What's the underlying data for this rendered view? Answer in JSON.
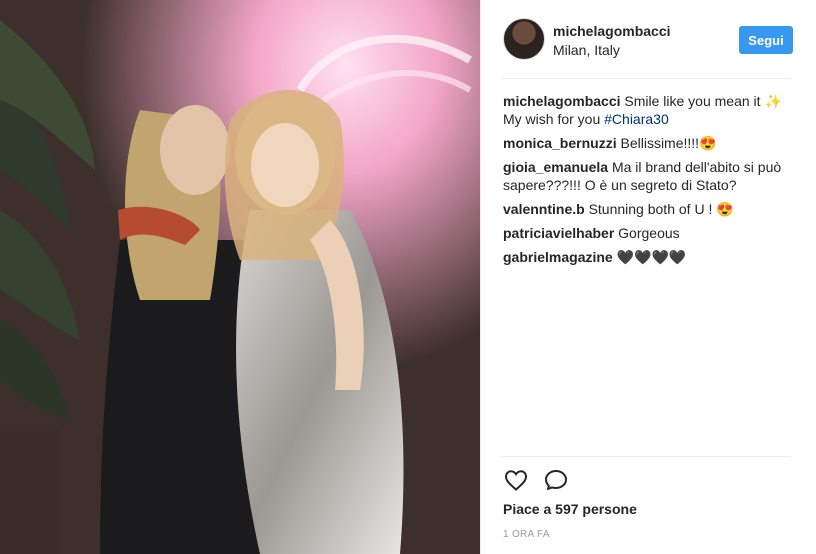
{
  "post": {
    "photo_description": "photo",
    "header": {
      "username": "michelagombacci",
      "location": "Milan, Italy",
      "follow_label": "Segui"
    },
    "caption": {
      "username": "michelagombacci",
      "text": "Smile like you mean it ✨ My wish for you ",
      "hashtag": "#Chiara30"
    },
    "comments": [
      {
        "username": "monica_bernuzzi",
        "text": "Bellissime!!!!😍"
      },
      {
        "username": "gioia_emanuela",
        "text": "Ma il brand dell'abito si può sapere???!!! O è un segreto di Stato?"
      },
      {
        "username": "valenntine.b",
        "text": "Stunning both of U ! 😍"
      },
      {
        "username": "patriciavielhaber",
        "text": "Gorgeous"
      },
      {
        "username": "gabrielmagazine",
        "text": "🖤🖤🖤🖤"
      }
    ],
    "actions": {
      "like_icon": "heart-icon",
      "comment_icon": "comment-icon"
    },
    "likes_text": "Piace a 597 persone",
    "timestamp": "1 ORA FA"
  }
}
